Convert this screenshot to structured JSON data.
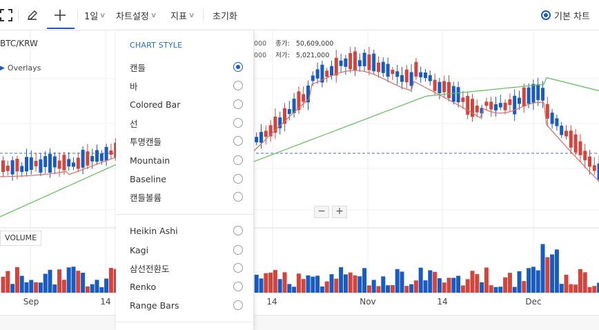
{
  "toolbar": {
    "interval_label": "1일",
    "chart_settings_label": "차트설정",
    "indicator_label": "지표",
    "reset_label": "초기화",
    "default_chart_label": "기본 차트"
  },
  "chart": {
    "symbol": "BTC/KRW",
    "overlays_label": "Overlays",
    "ohlc": {
      "open_partial": "000",
      "close_label": "종가:",
      "close_value": "50,609,000",
      "low_partial": "000",
      "low_label": "저가:",
      "low_value": "5,021,000"
    },
    "zoom_out": "−",
    "zoom_in": "+",
    "volume_label": "VOLUME",
    "x_ticks": [
      "Sep",
      "14",
      "14",
      "Nov",
      "14",
      "Dec"
    ]
  },
  "menu": {
    "title": "CHART STYLE",
    "items": [
      {
        "label": "캔들",
        "selected": true
      },
      {
        "label": "바",
        "selected": false
      },
      {
        "label": "Colored Bar",
        "selected": false
      },
      {
        "label": "선",
        "selected": false
      },
      {
        "label": "투명캔들",
        "selected": false
      },
      {
        "label": "Mountain",
        "selected": false
      },
      {
        "label": "Baseline",
        "selected": false
      },
      {
        "label": "캔들볼륨",
        "selected": false
      }
    ],
    "items2": [
      {
        "label": "Heikin Ashi",
        "selected": false
      },
      {
        "label": "Kagi",
        "selected": false
      },
      {
        "label": "삼선전환도",
        "selected": false
      },
      {
        "label": "Renko",
        "selected": false
      },
      {
        "label": "Range Bars",
        "selected": false
      }
    ]
  },
  "colors": {
    "up": "#d0463e",
    "down": "#1a5bbf",
    "ma_short": "#e06a60",
    "ma_long": "#5cbf55",
    "accent": "#1a5bbf"
  }
}
